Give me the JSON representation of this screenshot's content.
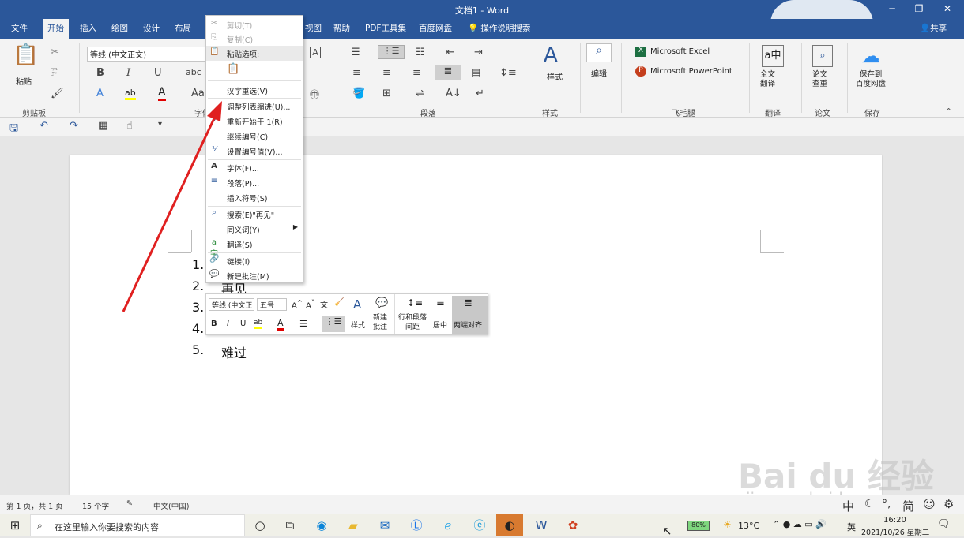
{
  "title": {
    "doc": "文档1 - Word",
    "share": "共享"
  },
  "tabs": [
    "文件",
    "开始",
    "插入",
    "绘图",
    "设计",
    "布局",
    "视图",
    "帮助",
    "PDF工具集",
    "百度网盘",
    "操作说明搜索"
  ],
  "ribbon": {
    "paste": "粘贴",
    "clipboard": "剪贴板",
    "font_name": "等线 (中文正文)",
    "font_group": "字体",
    "para": "段落",
    "style": "样式",
    "style_btn": "样式",
    "edit": "编辑",
    "excel": "Microsoft Excel",
    "ppt": "Microsoft PowerPoint",
    "feimao": "飞毛腿",
    "fulltrans": "全文\n翻译",
    "translate": "翻译",
    "paper_check": "论文\n查重",
    "paper": "论文",
    "save_bd": "保存到\n百度网盘",
    "save": "保存"
  },
  "context_menu": [
    {
      "label": "剪切(T)",
      "icon": "scissors-icon",
      "disabled": true
    },
    {
      "label": "复制(C)",
      "icon": "copy-icon",
      "disabled": true
    },
    {
      "label": "粘贴选项:",
      "icon": "paste-icon",
      "disabled": false
    },
    {
      "label": "汉字重选(V)",
      "icon": "",
      "disabled": false
    },
    {
      "label": "调整列表缩进(U)...",
      "icon": "",
      "disabled": false
    },
    {
      "label": "重新开始于 1(R)",
      "icon": "numbering-icon",
      "disabled": false
    },
    {
      "label": "继续编号(C)",
      "icon": "",
      "disabled": false
    },
    {
      "label": "设置编号值(V)...",
      "icon": "numbering-value-icon",
      "disabled": false
    },
    {
      "label": "字体(F)...",
      "icon": "font-icon",
      "disabled": false
    },
    {
      "label": "段落(P)...",
      "icon": "paragraph-icon",
      "disabled": false
    },
    {
      "label": "插入符号(S)",
      "icon": "",
      "disabled": false
    },
    {
      "label": "搜索(E)\"再见\"",
      "icon": "search-icon",
      "disabled": false
    },
    {
      "label": "同义词(Y)",
      "icon": "",
      "disabled": false
    },
    {
      "label": "翻译(S)",
      "icon": "translate-icon",
      "disabled": false
    },
    {
      "label": "链接(I)",
      "icon": "link-icon",
      "disabled": false
    },
    {
      "label": "新建批注(M)",
      "icon": "comment-icon",
      "disabled": false
    }
  ],
  "list": [
    {
      "num": "1.",
      "text": ""
    },
    {
      "num": "2.",
      "text": "再见"
    },
    {
      "num": "3.",
      "text": ""
    },
    {
      "num": "4.",
      "text": ""
    },
    {
      "num": "5.",
      "text": "难过"
    }
  ],
  "mini": {
    "font": "等线 (中文正",
    "size": "五号",
    "style": "样式",
    "comment": "新建\n批注",
    "spacing": "行和段落\n间距",
    "center": "居中",
    "justify": "两端对齐"
  },
  "status": {
    "page": "第 1 页，共 1 页",
    "words": "15 个字",
    "lang": "中文(中国)"
  },
  "taskbar": {
    "search": "在这里输入你要搜索的内容",
    "battery": "80%",
    "weather": "13°C",
    "ime": "英",
    "time": "16:20",
    "date": "2021/10/26 星期二"
  },
  "watermark": {
    "logo": "Bai du 经验",
    "url": "jingyan.baidu.com"
  },
  "ime_bar": [
    "中",
    "简"
  ],
  "colors": {
    "word_blue": "#2b579a",
    "arrow": "#e02020",
    "highlight": "#ffff00",
    "font_red": "#e00000"
  }
}
